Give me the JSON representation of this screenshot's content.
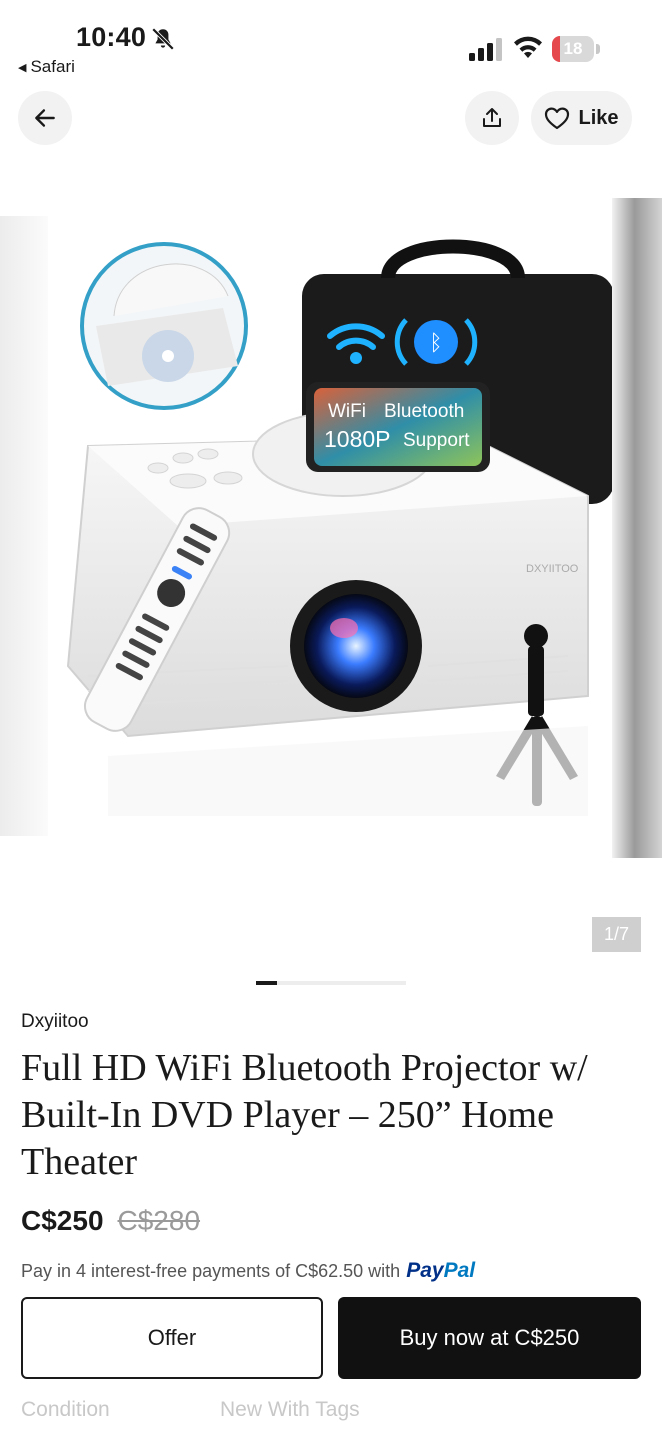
{
  "status_bar": {
    "time": "10:40",
    "back_app": "Safari",
    "battery_percent": "18",
    "battery_level": 0.18,
    "silent_icon": "bell-slash-icon"
  },
  "nav": {
    "back_icon": "arrow-left-icon",
    "share_icon": "share-icon",
    "like_label": "Like"
  },
  "gallery": {
    "counter": "1/7",
    "current_index": 1,
    "total": 7,
    "image_text": {
      "wifi": "WiFi",
      "bluetooth": "Bluetooth",
      "resolution": "1080P",
      "support": "Support",
      "brand_mark": "DXYIITOO"
    }
  },
  "product": {
    "brand": "Dxyiitoo",
    "title": "Full HD WiFi Bluetooth Projector w/ Built-In DVD Player – 250” Home Theater",
    "price": "C$250",
    "original_price": "C$280",
    "paypal_text": "Pay in 4 interest-free payments of C$62.50 with",
    "paypal_brand_a": "Pay",
    "paypal_brand_b": "Pal"
  },
  "actions": {
    "offer_label": "Offer",
    "buy_label": "Buy now at C$250"
  },
  "details": {
    "condition_label": "Condition",
    "condition_value": "New With Tags"
  },
  "colors": {
    "primary": "#111111",
    "battery_low": "#e5484d",
    "paypal_dark": "#003087",
    "paypal_light": "#0079c1"
  }
}
